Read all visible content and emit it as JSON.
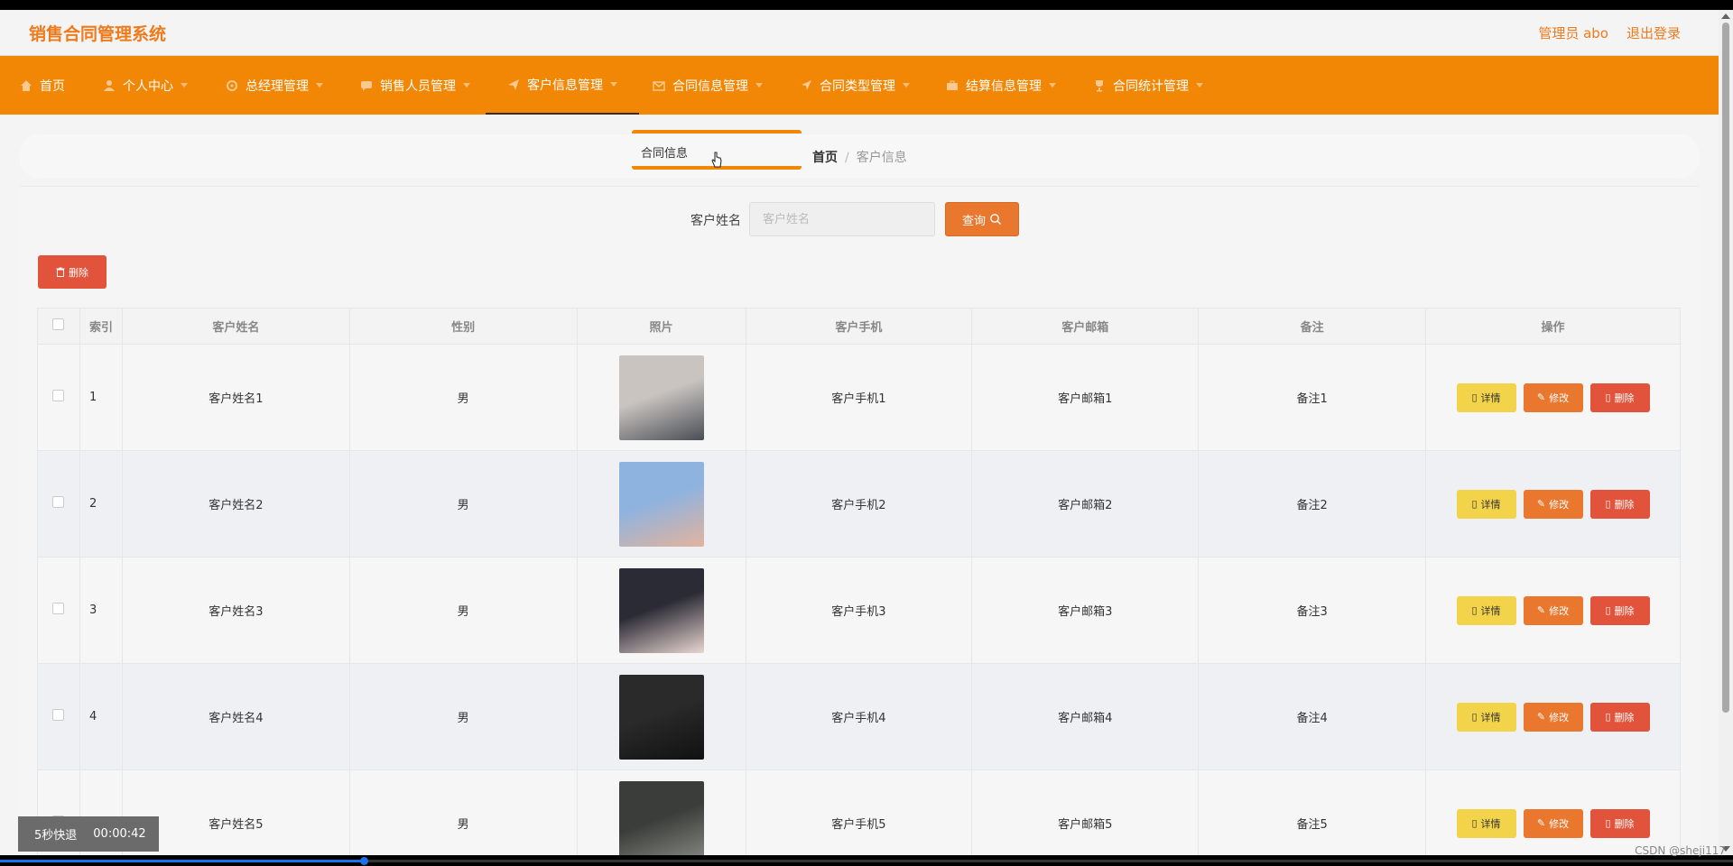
{
  "header": {
    "title": "销售合同管理系统",
    "user": "管理员 abo",
    "logout": "退出登录"
  },
  "nav": {
    "items": [
      {
        "label": "首页",
        "icon": "home-icon"
      },
      {
        "label": "个人中心",
        "icon": "user-icon"
      },
      {
        "label": "总经理管理",
        "icon": "settings-icon"
      },
      {
        "label": "销售人员管理",
        "icon": "chat-icon"
      },
      {
        "label": "客户信息管理",
        "icon": "send-icon"
      },
      {
        "label": "合同信息管理",
        "icon": "mail-icon"
      },
      {
        "label": "合同类型管理",
        "icon": "location-icon"
      },
      {
        "label": "结算信息管理",
        "icon": "briefcase-icon"
      },
      {
        "label": "合同统计管理",
        "icon": "trophy-icon"
      }
    ],
    "dropdown_item": "合同信息"
  },
  "breadcrumb": {
    "home": "首页",
    "separator": "/",
    "current": "客户信息"
  },
  "search": {
    "label": "客户姓名",
    "placeholder": "客户姓名",
    "button": "查询"
  },
  "toolbar": {
    "delete": "删除"
  },
  "table": {
    "headers": [
      "索引",
      "客户姓名",
      "性别",
      "照片",
      "客户手机",
      "客户邮箱",
      "备注",
      "操作"
    ],
    "rows": [
      {
        "index": "1",
        "name": "客户姓名1",
        "gender": "男",
        "phone": "客户手机1",
        "email": "客户邮箱1",
        "note": "备注1",
        "photo_colors": [
          "#c9c4c0",
          "#4a4e55"
        ]
      },
      {
        "index": "2",
        "name": "客户姓名2",
        "gender": "男",
        "phone": "客户手机2",
        "email": "客户邮箱2",
        "note": "备注2",
        "photo_colors": [
          "#8fb3df",
          "#e3b39d"
        ]
      },
      {
        "index": "3",
        "name": "客户姓名3",
        "gender": "男",
        "phone": "客户手机3",
        "email": "客户邮箱3",
        "note": "备注3",
        "photo_colors": [
          "#2b2b35",
          "#e9d6d2"
        ]
      },
      {
        "index": "4",
        "name": "客户姓名4",
        "gender": "男",
        "phone": "客户手机4",
        "email": "客户邮箱4",
        "note": "备注4",
        "photo_colors": [
          "#2a2a2a",
          "#111111"
        ]
      },
      {
        "index": "5",
        "name": "客户姓名5",
        "gender": "男",
        "phone": "客户手机5",
        "email": "客户邮箱5",
        "note": "备注5",
        "photo_colors": [
          "#3b3d3a",
          "#8c9088"
        ]
      }
    ],
    "actions": {
      "detail": "详情",
      "edit": "修改",
      "delete": "删除"
    }
  },
  "video_overlay": {
    "fast_forward": "5秒快退",
    "time": "00:00:42",
    "progress": 0.21
  },
  "watermark": "CSDN @sheji117",
  "colors": {
    "accent": "#f28706",
    "title": "#ef7a1c",
    "danger": "#e2533b",
    "warning": "#f2d34a"
  }
}
